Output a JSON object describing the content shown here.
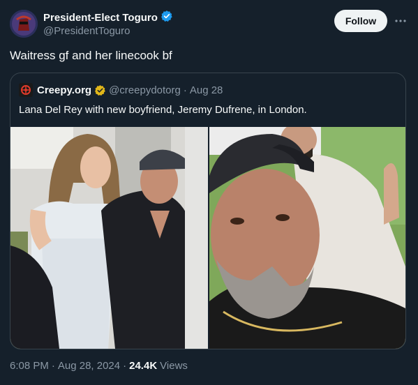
{
  "tweet": {
    "author": {
      "display_name": "President-Elect Toguro",
      "handle": "@PresidentToguro",
      "verified_icon": "verified-badge-icon"
    },
    "follow_label": "Follow",
    "more_icon": "more-options-icon",
    "text": "Waitress gf and her linecook bf",
    "timestamp_time": "6:08 PM",
    "separator": "·",
    "timestamp_date": "Aug 28, 2024",
    "views_count": "24.4K",
    "views_label": "Views"
  },
  "quote": {
    "display_name": "Creepy.org",
    "verified_icon": "gold-verified-badge-icon",
    "handle": "@creepydotorg",
    "separator": "·",
    "date": "Aug 28",
    "text": "Lana Del Rey with new boyfriend, Jeremy Dufrene, in London."
  },
  "colors": {
    "background": "#15202b",
    "text_primary": "#f7f9f9",
    "text_secondary": "#8b98a5",
    "border": "#38444d",
    "verified_blue": "#1d9bf0",
    "verified_gold": "#e2b719",
    "follow_bg": "#eff3f4"
  }
}
